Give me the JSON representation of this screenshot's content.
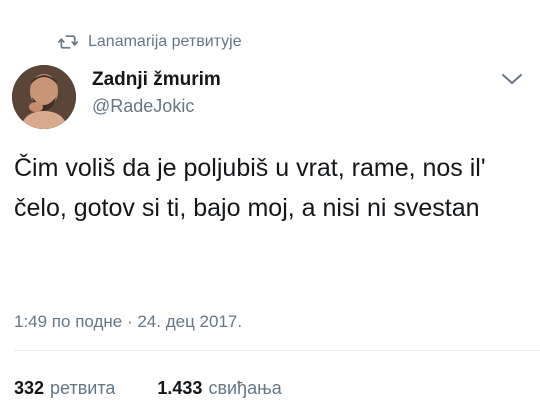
{
  "retweet_header": {
    "icon": "retweet-icon",
    "text": "Lanamarija ретвитује"
  },
  "author": {
    "display_name": "Zadnji žmurim",
    "handle": "@RadeJokic"
  },
  "tweet": {
    "text": "Čim voliš da je poljubiš u vrat, rame, nos il' čelo, gotov si ti, bajo moj, a nisi ni svestan"
  },
  "timestamp": "1:49 по подне · 24. дец 2017.",
  "stats": {
    "retweets_count": "332",
    "retweets_label": "ретвита",
    "likes_count": "1.433",
    "likes_label": "свиђања"
  },
  "colors": {
    "primary_text": "#14171a",
    "secondary_text": "#657786",
    "divider": "#e6ecf0"
  }
}
